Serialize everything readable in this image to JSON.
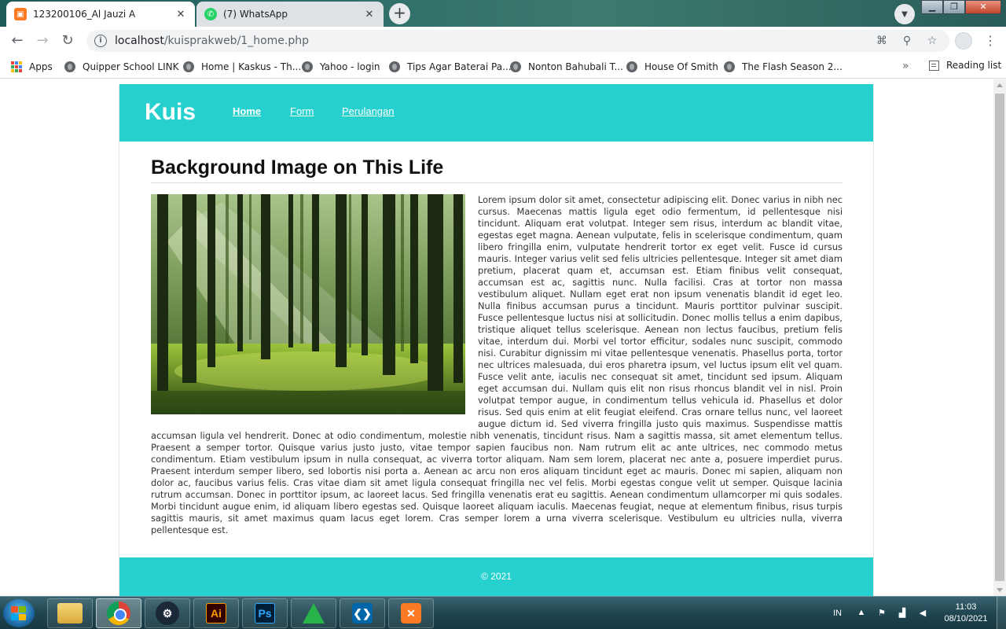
{
  "browser": {
    "tabs": [
      {
        "title": "123200106_Al Jauzi A",
        "favicon": "xampp-icon"
      },
      {
        "title": "(7) WhatsApp",
        "favicon": "whatsapp-icon"
      }
    ],
    "new_tab_label": "+",
    "url_host": "localhost",
    "url_path": "/kuisprakweb/1_home.php",
    "bookmarks": [
      {
        "label": "Apps"
      },
      {
        "label": "Quipper School LINK"
      },
      {
        "label": "Home | Kaskus - Th..."
      },
      {
        "label": "Yahoo - login"
      },
      {
        "label": "Tips Agar Baterai Pa..."
      },
      {
        "label": "Nonton Bahubali T..."
      },
      {
        "label": "House Of Smith"
      },
      {
        "label": "The Flash Season 2..."
      }
    ],
    "bookmarks_more": "»",
    "reading_list": "Reading list"
  },
  "site": {
    "brand": "Kuis",
    "nav": [
      {
        "label": "Home",
        "active": true
      },
      {
        "label": "Form",
        "active": false
      },
      {
        "label": "Perulangan",
        "active": false
      }
    ],
    "heading": "Background Image on This Life",
    "image_alt": "forest with sunlight",
    "body_text": "Lorem ipsum dolor sit amet, consectetur adipiscing elit. Donec varius in nibh nec cursus. Maecenas mattis ligula eget odio fermentum, id pellentesque nisi tincidunt. Aliquam erat volutpat. Integer sem risus, interdum ac blandit vitae, egestas eget magna. Aenean vulputate, felis in scelerisque condimentum, quam libero fringilla enim, vulputate hendrerit tortor ex eget velit. Fusce id cursus mauris. Integer varius velit sed felis ultricies pellentesque. Integer sit amet diam pretium, placerat quam et, accumsan est. Etiam finibus velit consequat, accumsan est ac, sagittis nunc. Nulla facilisi. Cras at tortor non massa vestibulum aliquet. Nullam eget erat non ipsum venenatis blandit id eget leo. Nulla finibus accumsan purus a tincidunt. Mauris porttitor pulvinar suscipit. Fusce pellentesque luctus nisi at sollicitudin. Donec mollis tellus a enim dapibus, tristique aliquet tellus scelerisque. Aenean non lectus faucibus, pretium felis vitae, interdum dui. Morbi vel tortor efficitur, sodales nunc suscipit, commodo nisi. Curabitur dignissim mi vitae pellentesque venenatis. Phasellus porta, tortor nec ultrices malesuada, dui eros pharetra ipsum, vel luctus ipsum elit vel quam. Fusce velit ante, iaculis nec consequat sit amet, tincidunt sed ipsum. Aliquam eget accumsan dui. Nullam quis elit non risus rhoncus blandit vel in nisl. Proin volutpat tempor augue, in condimentum tellus vehicula id. Phasellus et dolor risus. Sed quis enim at elit feugiat eleifend. Cras ornare tellus nunc, vel laoreet augue dictum id. Sed viverra fringilla justo quis maximus. Suspendisse mattis accumsan ligula vel hendrerit. Donec at odio condimentum, molestie nibh venenatis, tincidunt risus. Nam a sagittis massa, sit amet elementum tellus. Praesent a semper tortor. Quisque varius justo justo, vitae tempor sapien faucibus non. Nam rutrum elit ac ante ultrices, nec commodo metus condimentum. Etiam vestibulum ipsum in nulla consequat, ac viverra tortor aliquam. Nam sem lorem, placerat nec ante a, posuere imperdiet purus. Praesent interdum semper libero, sed lobortis nisi porta a. Aenean ac arcu non eros aliquam tincidunt eget ac mauris. Donec mi sapien, aliquam non dolor ac, faucibus varius felis. Cras vitae diam sit amet ligula consequat fringilla nec vel felis. Morbi egestas congue velit ut semper. Quisque lacinia rutrum accumsan. Donec in porttitor ipsum, ac laoreet lacus. Sed fringilla venenatis erat eu sagittis. Aenean condimentum ullamcorper mi quis sodales. Morbi tincidunt augue enim, id aliquam libero egestas sed. Quisque laoreet aliquam iaculis. Maecenas feugiat, neque at elementum finibus, risus turpis sagittis mauris, sit amet maximus quam lacus eget lorem. Cras semper lorem a urna viverra scelerisque. Vestibulum eu ultricies nulla, viverra pellentesque est.",
    "footer": "© 2021",
    "accent_color": "#26d0ce"
  },
  "taskbar": {
    "apps": [
      {
        "name": "explorer-icon",
        "label": ""
      },
      {
        "name": "chrome-icon",
        "label": "",
        "active": true
      },
      {
        "name": "steam-icon",
        "label": ""
      },
      {
        "name": "illustrator-icon",
        "label": "Ai"
      },
      {
        "name": "photoshop-icon",
        "label": "Ps"
      },
      {
        "name": "green-triangle-app-icon",
        "label": ""
      },
      {
        "name": "vscode-icon",
        "label": ""
      },
      {
        "name": "xampp-icon",
        "label": ""
      }
    ],
    "language": "IN",
    "time": "11:03",
    "date": "08/10/2021"
  }
}
